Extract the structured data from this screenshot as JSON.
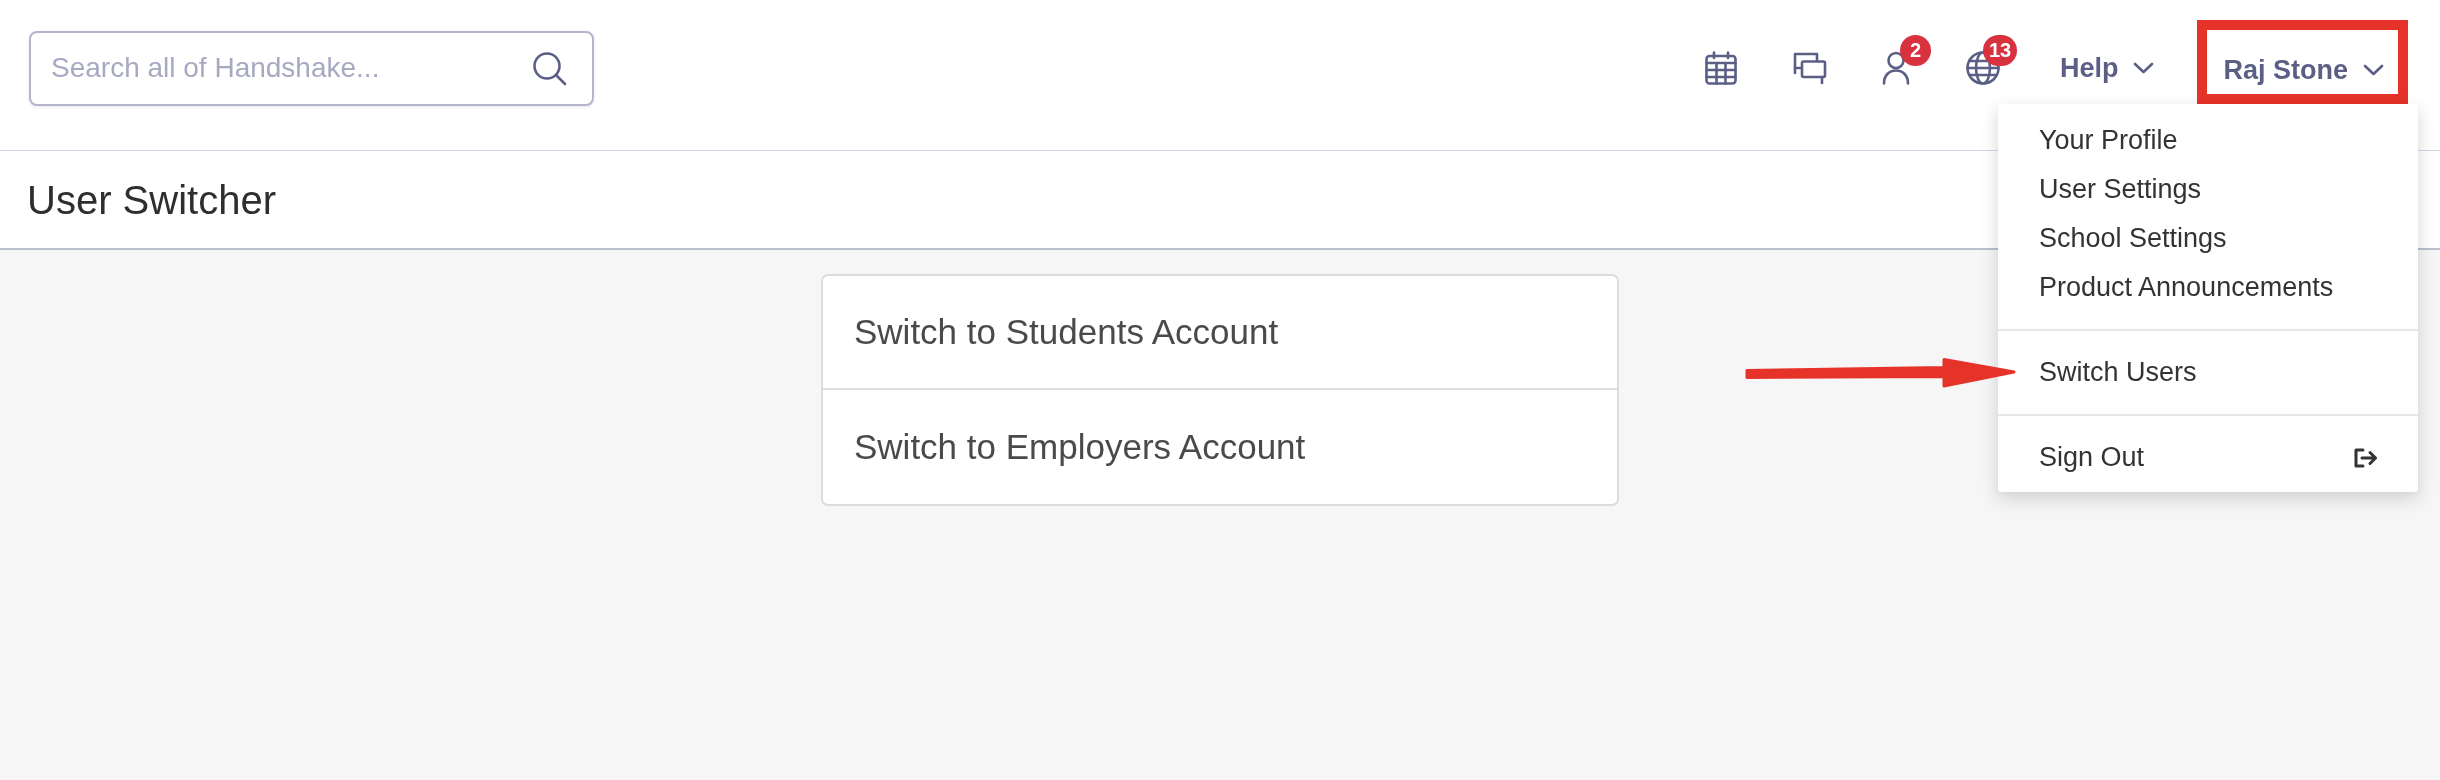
{
  "search": {
    "placeholder": "Search all of Handshake..."
  },
  "header": {
    "person_badge": "2",
    "globe_badge": "13"
  },
  "help_menu": {
    "label": "Help"
  },
  "user_menu": {
    "label": "Raj Stone",
    "highlighted": true,
    "expanded": true,
    "groups": [
      {
        "items": [
          {
            "label": "Your Profile",
            "kind": "plain",
            "arrow_pointer": false
          },
          {
            "label": "User Settings",
            "kind": "plain",
            "arrow_pointer": false
          },
          {
            "label": "School Settings",
            "kind": "plain",
            "arrow_pointer": false
          },
          {
            "label": "Product Announcements",
            "kind": "plain",
            "arrow_pointer": false
          }
        ]
      },
      {
        "items": [
          {
            "label": "Switch Users",
            "kind": "plain",
            "arrow_pointer": true
          }
        ]
      },
      {
        "items": [
          {
            "label": "Sign Out",
            "kind": "signout",
            "arrow_pointer": false
          }
        ]
      }
    ]
  },
  "page_title": "User Switcher",
  "account_options": [
    {
      "label": "Switch to Students Account"
    },
    {
      "label": "Switch to Employers Account"
    }
  ]
}
